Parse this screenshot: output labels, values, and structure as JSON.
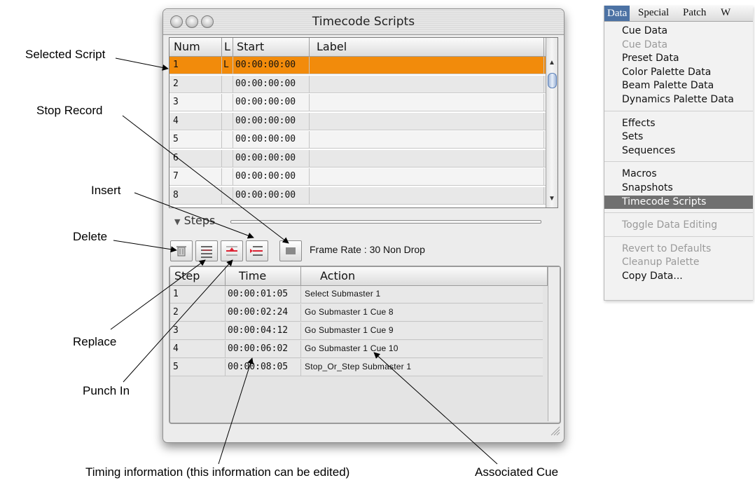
{
  "window": {
    "title": "Timecode Scripts",
    "scripts_table": {
      "headers": [
        "Num",
        "L",
        "Start",
        "Label"
      ],
      "rows": [
        {
          "num": "1",
          "l": "L",
          "start": "00:00:00:00",
          "label": "",
          "selected": true
        },
        {
          "num": "2",
          "l": "",
          "start": "00:00:00:00",
          "label": ""
        },
        {
          "num": "3",
          "l": "",
          "start": "00:00:00:00",
          "label": ""
        },
        {
          "num": "4",
          "l": "",
          "start": "00:00:00:00",
          "label": ""
        },
        {
          "num": "5",
          "l": "",
          "start": "00:00:00:00",
          "label": ""
        },
        {
          "num": "6",
          "l": "",
          "start": "00:00:00:00",
          "label": ""
        },
        {
          "num": "7",
          "l": "",
          "start": "00:00:00:00",
          "label": ""
        },
        {
          "num": "8",
          "l": "",
          "start": "00:00:00:00",
          "label": ""
        }
      ]
    },
    "steps_label": "Steps",
    "toolbar": {
      "buttons": [
        "delete",
        "replace",
        "punch-in",
        "insert",
        "stop-record"
      ],
      "frame_rate": "Frame Rate : 30 Non Drop"
    },
    "steps_table": {
      "headers": [
        "Step",
        "Time",
        "Action"
      ],
      "rows": [
        {
          "step": "1",
          "time": "00:00:01:05",
          "action": "Select Submaster 1"
        },
        {
          "step": "2",
          "time": "00:00:02:24",
          "action": "Go Submaster 1 Cue 8"
        },
        {
          "step": "3",
          "time": "00:00:04:12",
          "action": "Go Submaster 1 Cue 9"
        },
        {
          "step": "4",
          "time": "00:00:06:02",
          "action": "Go Submaster 1 Cue 10"
        },
        {
          "step": "5",
          "time": "00:00:08:05",
          "action": "Stop_Or_Step Submaster 1"
        }
      ]
    }
  },
  "callouts": {
    "selected_script": "Selected Script",
    "stop_record": "Stop Record",
    "insert": "Insert",
    "delete": "Delete",
    "replace": "Replace",
    "punch_in": "Punch In",
    "timing_info": "Timing information (this information can be edited)",
    "associated_cue": "Associated Cue"
  },
  "menu": {
    "menubar": [
      "Data",
      "Special",
      "Patch",
      "W"
    ],
    "active": "Data",
    "groups": [
      [
        {
          "label": "Cue Data",
          "enabled": true
        },
        {
          "label": "Cue Data",
          "enabled": false
        },
        {
          "label": "Preset Data",
          "enabled": true
        },
        {
          "label": "Color Palette Data",
          "enabled": true
        },
        {
          "label": "Beam Palette Data",
          "enabled": true
        },
        {
          "label": "Dynamics Palette Data",
          "enabled": true
        }
      ],
      [
        {
          "label": "Effects",
          "enabled": true
        },
        {
          "label": "Sets",
          "enabled": true
        },
        {
          "label": "Sequences",
          "enabled": true
        }
      ],
      [
        {
          "label": "Macros",
          "enabled": true
        },
        {
          "label": "Snapshots",
          "enabled": true
        },
        {
          "label": "Timecode Scripts",
          "enabled": true,
          "highlighted": true
        }
      ],
      [
        {
          "label": "Toggle Data Editing",
          "enabled": false
        }
      ],
      [
        {
          "label": "Revert to Defaults",
          "enabled": false
        },
        {
          "label": "Cleanup Palette",
          "enabled": false
        },
        {
          "label": "Copy Data...",
          "enabled": true
        }
      ]
    ]
  },
  "colors": {
    "selection": "#f28b0b",
    "menu_highlight": "#707070",
    "menubar_active": "#4c72a4"
  }
}
